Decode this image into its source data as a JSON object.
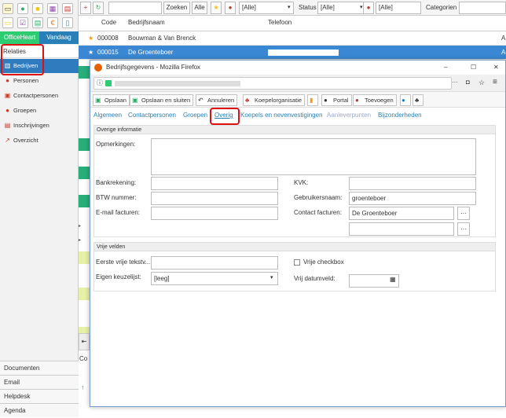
{
  "sidebar": {
    "tabs": [
      "OfficeHeart",
      "Vandaag"
    ],
    "section_label": "Relaties",
    "items": [
      {
        "label": "Bedrijven",
        "icon": "building-icon",
        "active": true
      },
      {
        "label": "Personen",
        "icon": "person-icon"
      },
      {
        "label": "Contactpersonen",
        "icon": "contact-icon"
      },
      {
        "label": "Groepen",
        "icon": "group-icon"
      },
      {
        "label": "Inschrijvingen",
        "icon": "registration-icon"
      },
      {
        "label": "Overzicht",
        "icon": "chart-icon"
      }
    ],
    "footer": [
      "Documenten",
      "Email",
      "Helpdesk",
      "Agenda"
    ]
  },
  "topbar": {
    "search_button": "Zoeken",
    "all_button": "Alle",
    "filter1": "[Alle]",
    "status_label": "Status",
    "status_value": "[Alle]",
    "filter3": "[Alle]",
    "categories_label": "Categorien"
  },
  "grid": {
    "columns": [
      "Code",
      "Bedrijfsnaam",
      "Telefoon"
    ],
    "rows": [
      {
        "code": "000008",
        "name": "Bouwman & Van Brenck",
        "extra": "A"
      },
      {
        "code": "000015",
        "name": "De Groenteboer",
        "extra": "A"
      }
    ],
    "bottom_label": "Co"
  },
  "firefox": {
    "title": "Bedrijfsgegevens - Mozilla Firefox",
    "window_controls": [
      "–",
      "☐",
      "✕"
    ],
    "toolbar": [
      {
        "label": "Opslaan",
        "icon": "save-icon"
      },
      {
        "label": "Opslaan en sluiten",
        "icon": "save-close-icon"
      },
      {
        "label": "Annuleren",
        "icon": "undo-icon"
      },
      {
        "label": "Koepelorganisatie",
        "icon": "hierarchy-icon"
      },
      {
        "label": "",
        "icon": "bar-chart-icon"
      },
      {
        "label": "Portal",
        "icon": "globe-icon"
      },
      {
        "label": "Toevoegen",
        "icon": "add-person-icon"
      }
    ],
    "tabs": [
      "Algemeen",
      "Contactpersonen",
      "Groepen",
      "Overig",
      "Koepels en nevenvestigingen",
      "Aanleverpunten",
      "Bijzonderheden"
    ],
    "overig": {
      "header": "Overige informatie",
      "opmerkingen_label": "Opmerkingen:",
      "bankrekening_label": "Bankrekening:",
      "btw_label": "BTW nummer:",
      "email_label": "E-mail facturen:",
      "kvk_label": "KVK:",
      "gebruikersnaam_label": "Gebruikersnaam:",
      "gebruikersnaam_value": "groenteboer",
      "contact_label": "Contact facturen:",
      "contact_value": "De Groenteboer"
    },
    "vrij": {
      "header": "Vrije velden",
      "tekst_label": "Eerste vrije tekstv...",
      "checkbox_label": "Vrije checkbox",
      "keuzelijst_label": "Eigen keuzelijst:",
      "keuzelijst_value": "[leeg]",
      "datum_label": "Vrij datumveld:"
    }
  }
}
